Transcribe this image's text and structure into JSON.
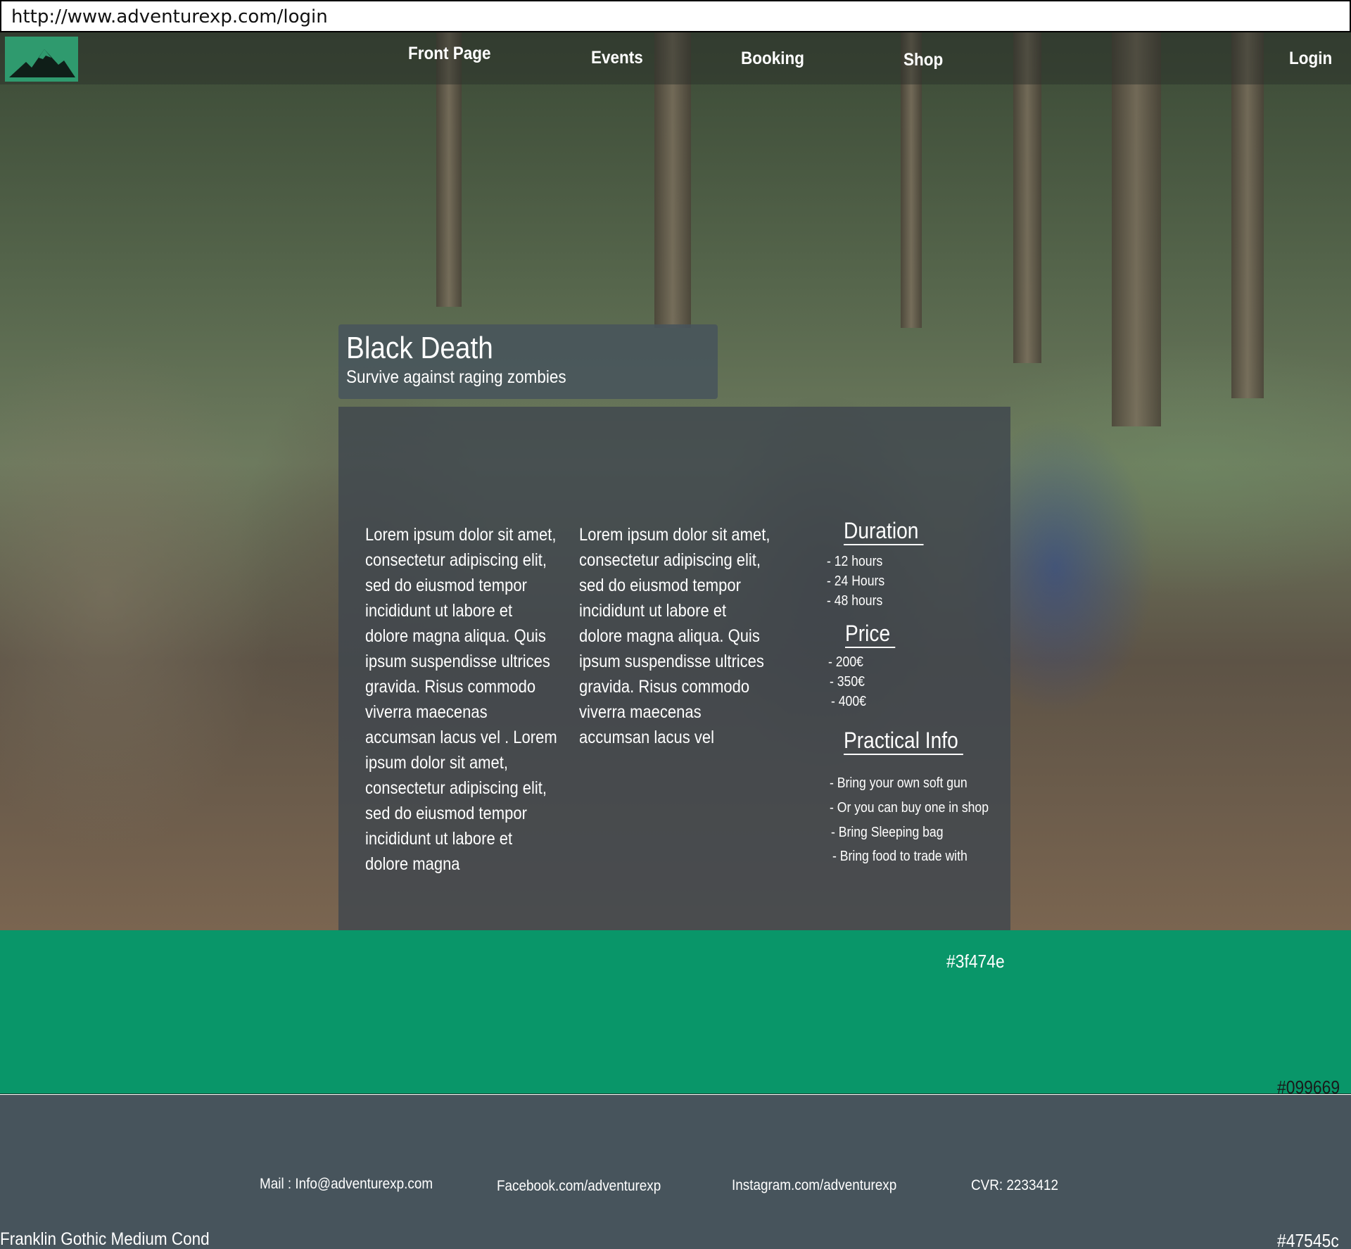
{
  "browser": {
    "url": "http://www.adventurexp.com/login"
  },
  "nav": {
    "logo": "mountain-logo",
    "links": [
      "Front Page",
      "Events",
      "Booking",
      "Shop"
    ],
    "login": "Login"
  },
  "event": {
    "title": "Black Death",
    "subtitle": "Survive against raging zombies",
    "column1": "Lorem ipsum dolor sit amet, consectetur adipiscing elit, sed do eiusmod tempor incididunt ut labore et dolore magna aliqua. Quis ipsum suspendisse ultrices gravida. Risus commodo viverra maecenas accumsan lacus vel . Lorem ipsum dolor sit amet, consectetur adipiscing elit, sed do eiusmod tempor incididunt ut labore et dolore magna",
    "column2": "Lorem ipsum dolor sit amet, consectetur adipiscing elit, sed do eiusmod tempor incididunt ut labore et dolore magna aliqua. Quis ipsum suspendisse ultrices gravida. Risus commodo viverra maecenas accumsan lacus vel",
    "duration": {
      "heading": "Duration",
      "items": [
        "- 12 hours",
        "- 24 Hours",
        "- 48 hours"
      ]
    },
    "price": {
      "heading": "Price",
      "items": [
        "- 200€",
        "- 350€",
        "- 400€"
      ]
    },
    "practical": {
      "heading": "Practical Info",
      "items": [
        "- Bring your own soft gun",
        "- Or  you can buy one in shop",
        "- Bring Sleeping bag",
        "- Bring food to trade with"
      ]
    },
    "panel_color_label": "#3f474e"
  },
  "band": {
    "color_label": "#099669"
  },
  "footer": {
    "mail": "Mail : Info@adventurexp.com",
    "facebook": "Facebook.com/adventurexp",
    "instagram": "Instagram.com/adventurexp",
    "cvr": "CVR: 2233412",
    "font_note": "Franklin Gothic Medium Cond",
    "color_label": "#47545c"
  },
  "colors": {
    "panel": "#3f474e",
    "band": "#099669",
    "footer": "#47545c",
    "logo": "#2f9a6e"
  }
}
